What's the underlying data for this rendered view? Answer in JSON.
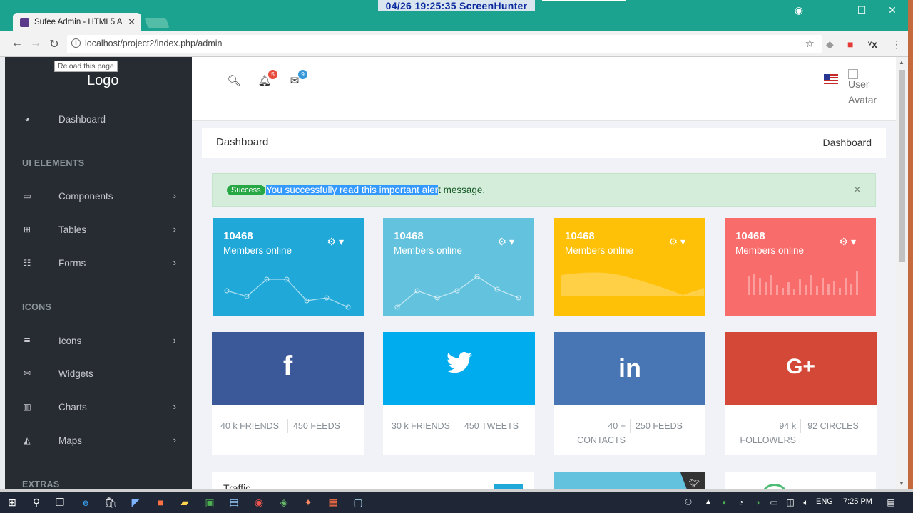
{
  "browser": {
    "tab_title": "Sufee Admin - HTML5 A",
    "url": "localhost/project2/index.php/admin",
    "tooltip": "Reload this page"
  },
  "overlay": {
    "screenhunter": "04/26  19:25:35  ScreenHunter"
  },
  "sidebar": {
    "logo": "Logo",
    "dashboard": "Dashboard",
    "sections": [
      "UI ELEMENTS",
      "ICONS",
      "EXTRAS"
    ],
    "ui_items": [
      {
        "label": "Components",
        "icon": "laptop-icon"
      },
      {
        "label": "Tables",
        "icon": "table-icon"
      },
      {
        "label": "Forms",
        "icon": "grid-icon"
      }
    ],
    "icon_items": [
      {
        "label": "Icons",
        "icon": "list-icon"
      },
      {
        "label": "Widgets",
        "icon": "envelope-icon"
      },
      {
        "label": "Charts",
        "icon": "bar-chart-icon"
      },
      {
        "label": "Maps",
        "icon": "area-chart-icon"
      }
    ]
  },
  "header": {
    "notifications_count": "5",
    "messages_count": "9",
    "avatar_alt": "User Avatar"
  },
  "page": {
    "title": "Dashboard",
    "breadcrumb": "Dashboard"
  },
  "alert": {
    "badge": "Success",
    "message_selected": "You successfully read this important aler",
    "message_rest": "t message.",
    "close": "×"
  },
  "stats": [
    {
      "value": "10468",
      "label": "Members online",
      "color": "#20a8d8",
      "kind": "line"
    },
    {
      "value": "10468",
      "label": "Members online",
      "color": "#63c2de",
      "kind": "line"
    },
    {
      "value": "10468",
      "label": "Members online",
      "color": "#ffc107",
      "kind": "area"
    },
    {
      "value": "10468",
      "label": "Members online",
      "color": "#f86c6b",
      "kind": "bar"
    }
  ],
  "social": [
    {
      "network": "facebook",
      "glyph": "f",
      "color": "#3b5998",
      "left_value": "40 k FRIENDS",
      "right_value": "450 FEEDS"
    },
    {
      "network": "twitter",
      "glyph": "🐦",
      "color": "#00aced",
      "left_value": "30 k FRIENDS",
      "right_value": "450 TWEETS"
    },
    {
      "network": "linkedin",
      "glyph": "in",
      "color": "#4875b4",
      "left_value_l1": "40 +",
      "left_value_l2": "CONTACTS",
      "right_value": "250 FEEDS"
    },
    {
      "network": "google-plus",
      "glyph": "G+",
      "color": "#d34836",
      "left_value_l1": "94 k",
      "left_value_l2": "FOLLOWERS",
      "right_value": "92 CIRCLES"
    }
  ],
  "bottom": {
    "traffic_peek": "Traffic"
  },
  "taskbar": {
    "lang": "ENG",
    "time": "7:25 PM"
  }
}
